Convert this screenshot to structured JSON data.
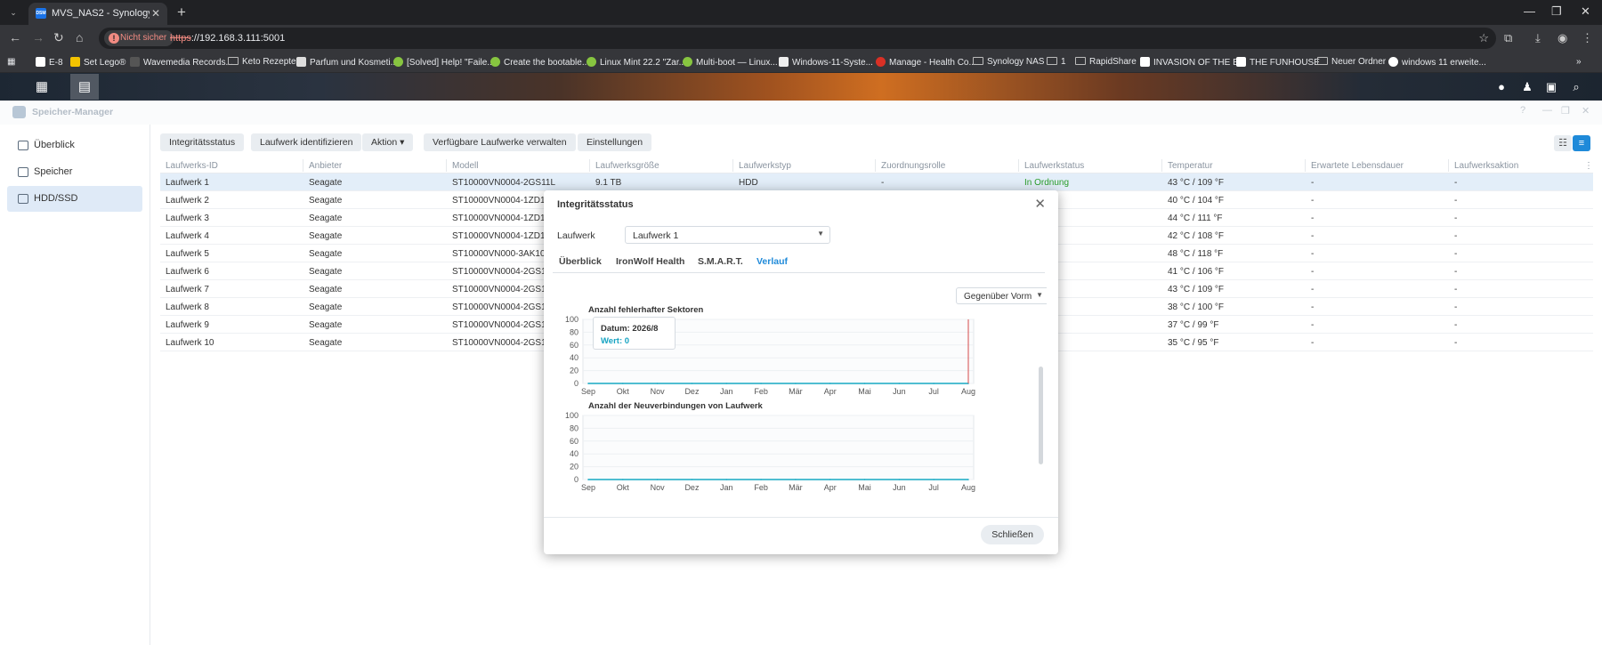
{
  "browser": {
    "tab_title": "MVS_NAS2 - Synology DiskStation",
    "tab_favicon": "DSM",
    "security_label": "Nicht sicher",
    "url_scheme": "https",
    "url_rest": "://192.168.3.111:5001",
    "bookmarks": [
      {
        "label": "E-8",
        "icon": "r-icon"
      },
      {
        "label": "Set Lego®",
        "icon": "lego-icon"
      },
      {
        "label": "Wavemedia Records...",
        "icon": "wave-icon"
      },
      {
        "label": "Keto Rezepte",
        "icon": "folder-icon"
      },
      {
        "label": "Parfum und Kosmeti...",
        "icon": "parfum-icon"
      },
      {
        "label": "[Solved] Help! \"Faile...",
        "icon": "mint-icon"
      },
      {
        "label": "Create the bootable...",
        "icon": "mint-icon"
      },
      {
        "label": "Linux Mint 22.2 \"Zar...",
        "icon": "mint-icon"
      },
      {
        "label": "Multi-boot — Linux...",
        "icon": "mint-icon"
      },
      {
        "label": "Windows-11-Syste...",
        "icon": "windows-icon"
      },
      {
        "label": "Manage - Health Co...",
        "icon": "health-icon"
      },
      {
        "label": "Synology NAS",
        "icon": "folder-icon"
      },
      {
        "label": "1",
        "icon": "folder-icon"
      },
      {
        "label": "RapidShare",
        "icon": "folder-icon"
      },
      {
        "label": "INVASION OF THE B...",
        "icon": "film-icon"
      },
      {
        "label": "THE FUNHOUSE",
        "icon": "film-icon"
      },
      {
        "label": "Neuer Ordner",
        "icon": "folder-icon"
      },
      {
        "label": "windows 11 erweite...",
        "icon": "google-icon"
      }
    ]
  },
  "window": {
    "title": "Speicher-Manager"
  },
  "sidebar": {
    "items": [
      {
        "label": "Überblick"
      },
      {
        "label": "Speicher"
      },
      {
        "label": "HDD/SSD"
      }
    ]
  },
  "toolbar": {
    "buttons": [
      {
        "label": "Integritätsstatus"
      },
      {
        "label": "Laufwerk identifizieren"
      },
      {
        "label": "Aktion ▾"
      },
      {
        "label": "Verfügbare Laufwerke verwalten"
      },
      {
        "label": "Einstellungen"
      }
    ]
  },
  "grid": {
    "headers": [
      "Laufwerks-ID",
      "Anbieter",
      "Modell",
      "Laufwerksgröße",
      "Laufwerkstyp",
      "Zuordnungsrolle",
      "Laufwerkstatus",
      "Temperatur",
      "Erwartete Lebensdauer",
      "Laufwerksaktion"
    ],
    "rows": [
      {
        "id": "Laufwerk 1",
        "vendor": "Seagate",
        "model": "ST10000VN0004-2GS11L",
        "size": "9.1 TB",
        "type": "HDD",
        "role": "-",
        "status": "In Ordnung",
        "temp": "43 °C / 109 °F",
        "life": "-",
        "action": "-"
      },
      {
        "id": "Laufwerk 2",
        "vendor": "Seagate",
        "model": "ST10000VN0004-1ZD1",
        "status": "ung",
        "temp": "40 °C / 104 °F",
        "life": "-",
        "action": "-"
      },
      {
        "id": "Laufwerk 3",
        "vendor": "Seagate",
        "model": "ST10000VN0004-1ZD1",
        "status": "ung",
        "temp": "44 °C / 111 °F",
        "life": "-",
        "action": "-"
      },
      {
        "id": "Laufwerk 4",
        "vendor": "Seagate",
        "model": "ST10000VN0004-1ZD1",
        "status": "ung",
        "temp": "42 °C / 108 °F",
        "life": "-",
        "action": "-"
      },
      {
        "id": "Laufwerk 5",
        "vendor": "Seagate",
        "model": "ST10000VN000-3AK10",
        "status": "ung",
        "temp": "48 °C / 118 °F",
        "life": "-",
        "action": "-"
      },
      {
        "id": "Laufwerk 6",
        "vendor": "Seagate",
        "model": "ST10000VN0004-2GS1",
        "status": "ung",
        "temp": "41 °C / 106 °F",
        "life": "-",
        "action": "-"
      },
      {
        "id": "Laufwerk 7",
        "vendor": "Seagate",
        "model": "ST10000VN0004-2GS1",
        "status": "ung",
        "temp": "43 °C / 109 °F",
        "life": "-",
        "action": "-"
      },
      {
        "id": "Laufwerk 8",
        "vendor": "Seagate",
        "model": "ST10000VN0004-2GS1",
        "status": "ung",
        "temp": "38 °C / 100 °F",
        "life": "-",
        "action": "-"
      },
      {
        "id": "Laufwerk 9",
        "vendor": "Seagate",
        "model": "ST10000VN0004-2GS1",
        "status": "ung",
        "temp": "37 °C / 99 °F",
        "life": "-",
        "action": "-"
      },
      {
        "id": "Laufwerk 10",
        "vendor": "Seagate",
        "model": "ST10000VN0004-2GS1",
        "status": "ung",
        "temp": "35 °C / 95 °F",
        "life": "-",
        "action": "-"
      }
    ]
  },
  "modal": {
    "title": "Integritätsstatus",
    "drive_label": "Laufwerk",
    "drive_value": "Laufwerk 1",
    "tabs": [
      "Überblick",
      "IronWolf Health",
      "S.M.A.R.T.",
      "Verlauf"
    ],
    "active_tab": "Verlauf",
    "compare_value": "Gegenüber Vorm",
    "tooltip": {
      "date": "Datum: 2026/8",
      "value": "Wert: 0"
    },
    "close_label": "Schließen"
  },
  "chart_data": [
    {
      "type": "line",
      "title": "Anzahl fehlerhafter Sektoren",
      "categories": [
        "Sep",
        "Okt",
        "Nov",
        "Dez",
        "Jan",
        "Feb",
        "Mär",
        "Apr",
        "Mai",
        "Jun",
        "Jul",
        "Aug"
      ],
      "values": [
        0,
        0,
        0,
        0,
        0,
        0,
        0,
        0,
        0,
        0,
        0,
        0
      ],
      "ylim": [
        0,
        100
      ],
      "yticks": [
        0,
        20,
        40,
        60,
        80,
        100
      ],
      "highlight_category": "Aug",
      "colors": {
        "line": "#17a9c4",
        "marker": "#d64a4a"
      }
    },
    {
      "type": "line",
      "title": "Anzahl der Neuverbindungen von Laufwerk",
      "categories": [
        "Sep",
        "Okt",
        "Nov",
        "Dez",
        "Jan",
        "Feb",
        "Mär",
        "Apr",
        "Mai",
        "Jun",
        "Jul",
        "Aug"
      ],
      "values": [
        0,
        0,
        0,
        0,
        0,
        0,
        0,
        0,
        0,
        0,
        0,
        0
      ],
      "ylim": [
        0,
        100
      ],
      "yticks": [
        0,
        20,
        40,
        60,
        80,
        100
      ],
      "colors": {
        "line": "#17a9c4"
      }
    }
  ]
}
